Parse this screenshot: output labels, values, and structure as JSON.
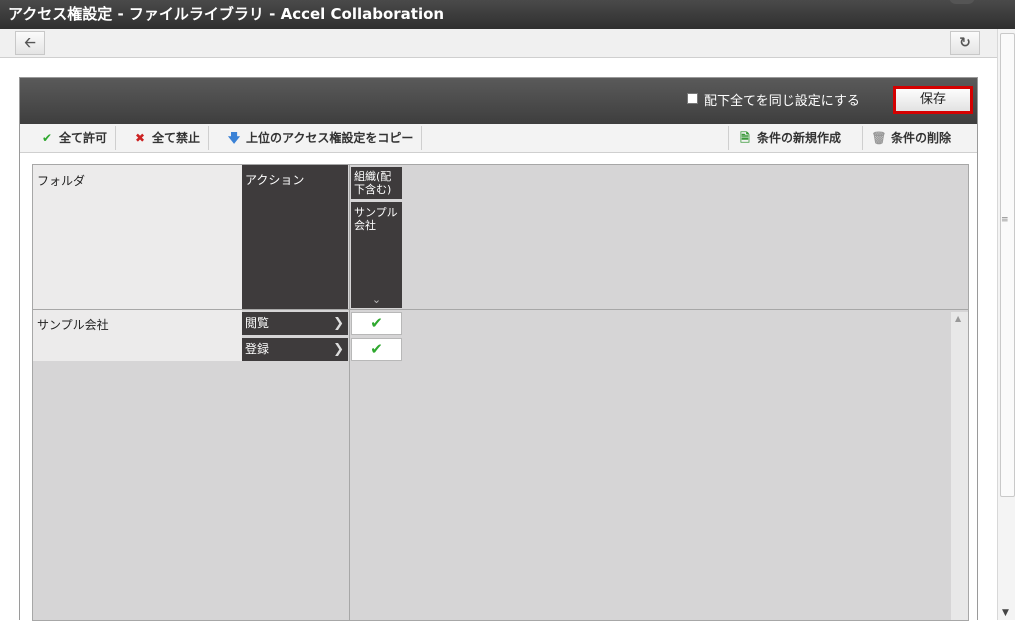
{
  "window": {
    "title": "アクセス権設定 - ファイルライブラリ - Accel Collaboration"
  },
  "nav": {
    "back_icon": "arrow-left-icon",
    "refresh_icon": "refresh-icon"
  },
  "panel": {
    "apply_all_label": "配下全てを同じ設定にする",
    "save_label": "保存"
  },
  "toolbar": {
    "allow_all": "全て許可",
    "deny_all": "全て禁止",
    "copy_parent": "上位のアクセス権設定をコピー",
    "new_condition": "条件の新規作成",
    "delete_condition": "条件の削除"
  },
  "grid": {
    "folder_header": "フォルダ",
    "action_header": "アクション",
    "org_header": "組織(配下含む)",
    "subject": "サンプル会社",
    "row_label": "サンプル会社",
    "actions": [
      {
        "label": "閲覧",
        "allowed": true
      },
      {
        "label": "登録",
        "allowed": true
      }
    ]
  },
  "colors": {
    "save_highlight": "#d40000",
    "check": "#2ea82e",
    "header_dark": "#3e3b3c"
  }
}
